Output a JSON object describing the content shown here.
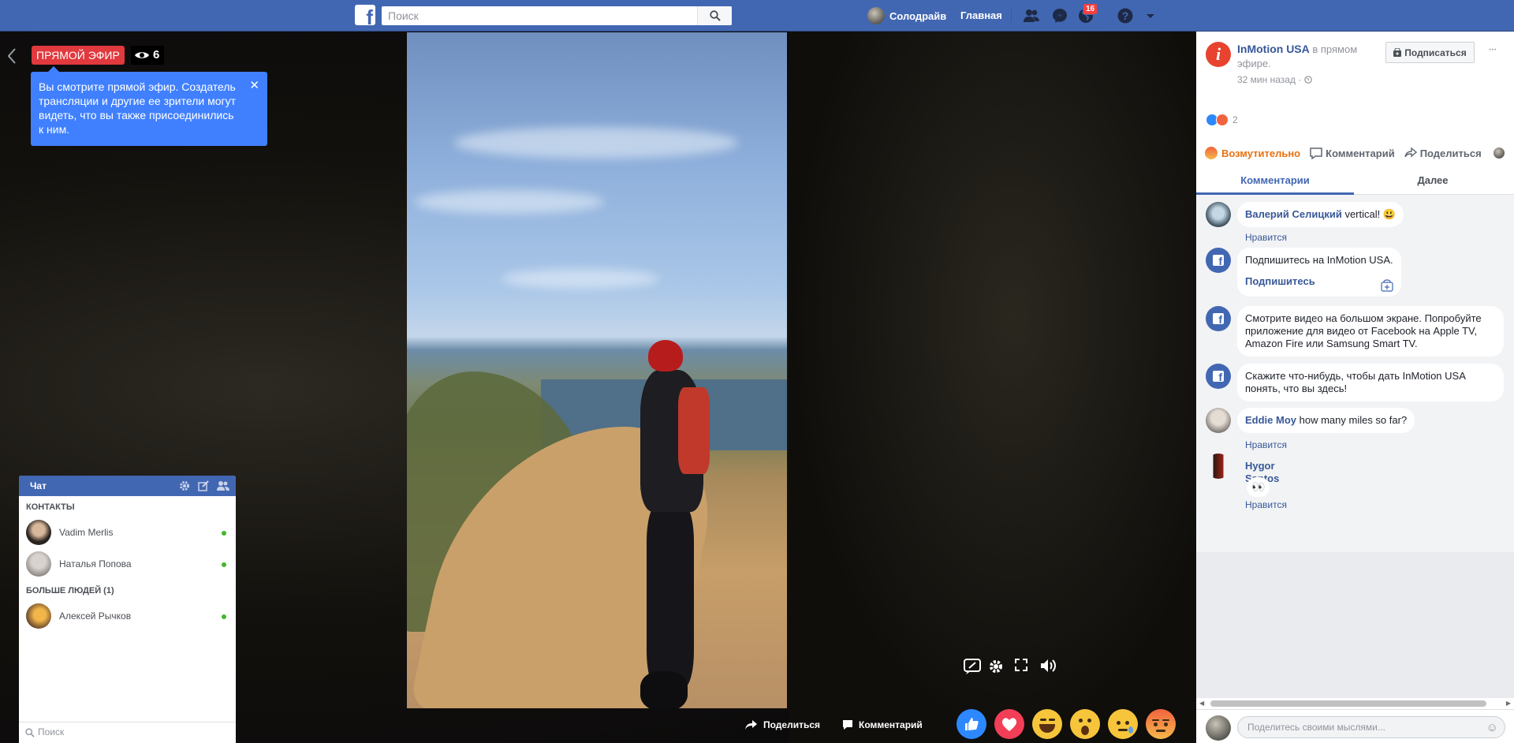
{
  "topbar": {
    "logo": "f",
    "search_placeholder": "Поиск",
    "profile_name": "Солодрайв",
    "home_label": "Главная",
    "notifications_count": "16",
    "icons": [
      "friends-icon",
      "messenger-icon",
      "globe-icon",
      "help-icon",
      "caret-down-icon"
    ]
  },
  "live": {
    "badge": "ПРЯМОЙ ЭФИР",
    "viewers": "6",
    "tooltip": "Вы смотрите прямой эфир. Создатель трансляции и другие ее зрители могут видеть, что вы также присоединились к ним.",
    "tooltip_close": "✕"
  },
  "player": {
    "controls": [
      "chat-toggle-icon",
      "settings-icon",
      "fullscreen-icon",
      "volume-icon"
    ],
    "share_label": "Поделиться",
    "comment_label": "Комментарий",
    "reactions": [
      "like",
      "love",
      "haha",
      "wow",
      "sad",
      "angry"
    ]
  },
  "chat": {
    "title": "Чат",
    "contacts_label": "КОНТАКТЫ",
    "contacts": [
      {
        "name": "Vadim Merlis",
        "online": true
      },
      {
        "name": "Наталья Попова",
        "online": true
      }
    ],
    "more_label": "БОЛЬШЕ ЛЮДЕЙ (1)",
    "more": [
      {
        "name": "Алексей Рычков",
        "online": true
      }
    ],
    "search_placeholder": "Поиск"
  },
  "post": {
    "page_name": "InMotion USA",
    "status": " в прямом эфире.",
    "time": "32 мин назад · ",
    "subscribe_label": "Подписаться",
    "more": "···",
    "reaction_count": "2",
    "my_reaction": "Возмутительно",
    "comment_label": "Комментарий",
    "share_label": "Поделиться"
  },
  "tabs": {
    "active": "Комментарии",
    "next": "Далее"
  },
  "comments": [
    {
      "author": "Валерий Селицкий",
      "text": " vertical! ",
      "emoji": "😃",
      "like": "Нравится"
    },
    {
      "system": "Подпишитесь на InMotion USA.",
      "action": "Подпишитесь"
    },
    {
      "system": "Смотрите видео на большом экране. Попробуйте приложение для видео от Facebook на Apple TV, Amazon Fire или Samsung Smart TV."
    },
    {
      "system": "Скажите что-нибудь, чтобы дать InMotion USA понять, что вы здесь!"
    },
    {
      "author": "Eddie Moy",
      "text": " how many miles so far?",
      "like": "Нравится"
    },
    {
      "author": "Hygor Santos",
      "text": "👀",
      "like": "Нравится"
    }
  ],
  "composer": {
    "placeholder": "Поделитесь своими мыслями...",
    "smile": "☺"
  },
  "colors": {
    "brand": "#4267b2",
    "live_red": "#e0393e",
    "tooltip_blue": "#4080ff",
    "angry": "#f0633f"
  }
}
